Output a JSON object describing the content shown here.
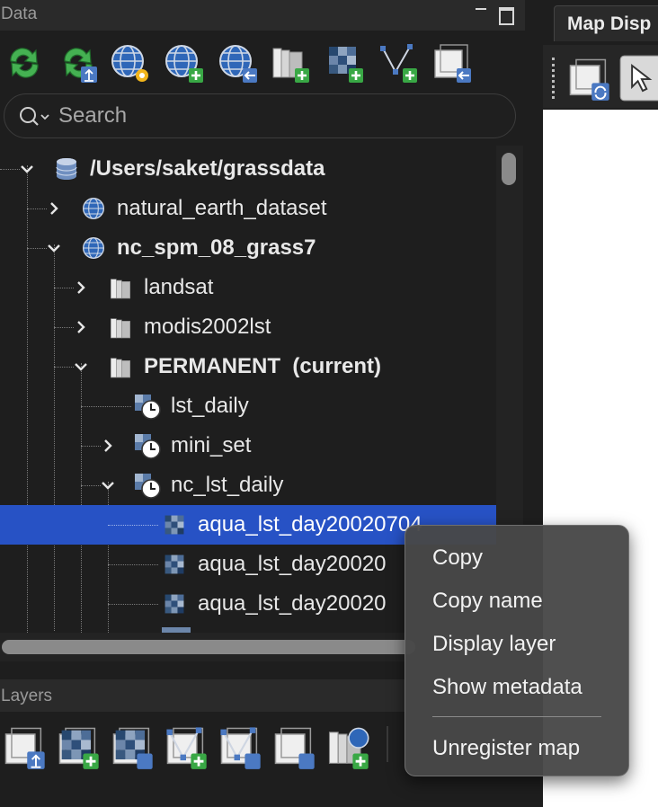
{
  "data_panel": {
    "title": "Data"
  },
  "layers_panel": {
    "title": "Layers"
  },
  "search": {
    "placeholder": "Search"
  },
  "tree": {
    "rows": [
      {
        "label": "/Users/saket/grassdata",
        "icon": "database-icon",
        "expanded": true
      },
      {
        "label": "natural_earth_dataset",
        "icon": "globe-icon",
        "expanded": false
      },
      {
        "label": "nc_spm_08_grass7",
        "icon": "globe-icon",
        "expanded": true
      },
      {
        "label": "landsat",
        "icon": "mapset-icon",
        "expanded": false
      },
      {
        "label": "modis2002lst",
        "icon": "mapset-icon",
        "expanded": false
      },
      {
        "label": "PERMANENT  (current)",
        "icon": "mapset-icon",
        "expanded": true
      },
      {
        "label": "lst_daily",
        "icon": "timeseries-icon"
      },
      {
        "label": "mini_set",
        "icon": "timeseries-icon",
        "expanded": false
      },
      {
        "label": "nc_lst_daily",
        "icon": "timeseries-icon",
        "expanded": true
      },
      {
        "label": "aqua_lst_day20020704",
        "icon": "raster-icon",
        "selected": true
      },
      {
        "label": "aqua_lst_day20020",
        "icon": "raster-icon"
      },
      {
        "label": "aqua_lst_day20020",
        "icon": "raster-icon"
      }
    ]
  },
  "map_display": {
    "tab_label": "Map Disp"
  },
  "context_menu": {
    "items": [
      "Copy",
      "Copy name",
      "Display layer",
      "Show metadata",
      "Unregister map"
    ]
  },
  "colors": {
    "selection": "#2752c5",
    "panel_bg": "#1e1e1e",
    "header_bg": "#2a2a2a",
    "menu_bg": "#484848",
    "refresh_green": "#3aa54a",
    "add_green": "#39a845"
  }
}
